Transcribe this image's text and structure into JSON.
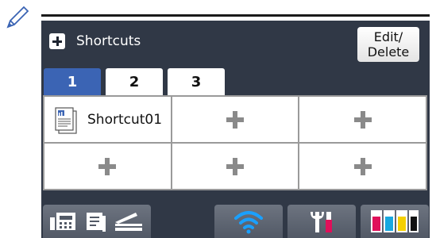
{
  "header": {
    "title": "Shortcuts",
    "edit_label": "Edit/\nDelete"
  },
  "tabs": [
    {
      "label": "1",
      "active": true
    },
    {
      "label": "2",
      "active": false
    },
    {
      "label": "3",
      "active": false
    }
  ],
  "shortcuts": {
    "row1": [
      "Shortcut01",
      "+",
      "+"
    ],
    "row2": [
      "+",
      "+",
      "+"
    ]
  },
  "bottom_icons": [
    "fax-icon",
    "copy-icon",
    "scan-icon",
    "wifi-icon",
    "settings-icon",
    "ink-icon"
  ],
  "colors": {
    "screen_bg": "#303846",
    "active_tab": "#3b64b4",
    "ink_magenta": "#e0105a",
    "ink_cyan": "#18a8e0",
    "ink_yellow": "#f5d000",
    "ink_black": "#111111"
  }
}
